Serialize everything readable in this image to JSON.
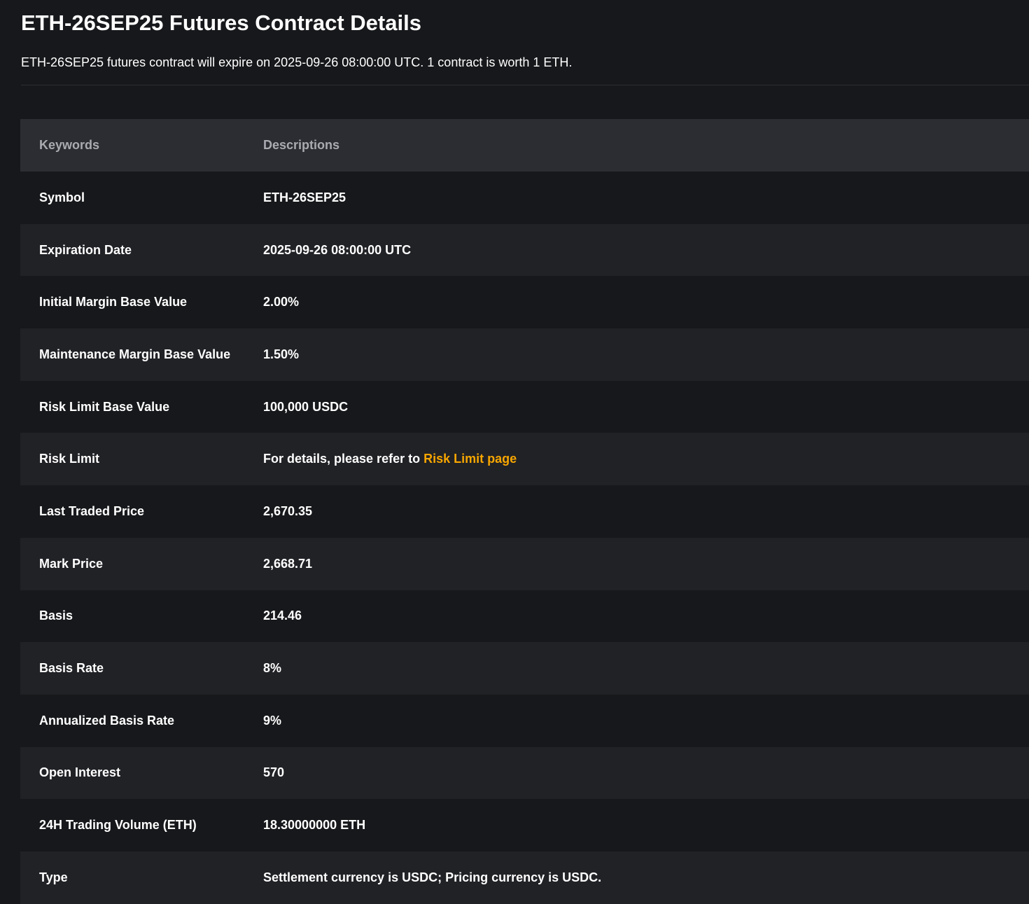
{
  "page": {
    "title": "ETH-26SEP25 Futures Contract Details",
    "subtitle": "ETH-26SEP25 futures contract will expire on 2025-09-26 08:00:00 UTC. 1 contract is worth 1 ETH."
  },
  "table": {
    "headers": {
      "keyword": "Keywords",
      "description": "Descriptions"
    },
    "rows": [
      {
        "key": "Symbol",
        "value": "ETH-26SEP25"
      },
      {
        "key": "Expiration Date",
        "value": "2025-09-26 08:00:00 UTC"
      },
      {
        "key": "Initial Margin Base Value",
        "value": "2.00%"
      },
      {
        "key": "Maintenance Margin Base Value",
        "value": "1.50%"
      },
      {
        "key": "Risk Limit Base Value",
        "value": "100,000 USDC"
      },
      {
        "key": "Risk Limit",
        "value": "For details, please refer to ",
        "link": "Risk Limit page"
      },
      {
        "key": "Last Traded Price",
        "value": "2,670.35"
      },
      {
        "key": "Mark Price",
        "value": "2,668.71"
      },
      {
        "key": "Basis",
        "value": "214.46"
      },
      {
        "key": "Basis Rate",
        "value": "8%"
      },
      {
        "key": "Annualized Basis Rate",
        "value": "9%"
      },
      {
        "key": "Open Interest",
        "value": "570"
      },
      {
        "key": "24H Trading Volume (ETH)",
        "value": "18.30000000 ETH"
      },
      {
        "key": "Type",
        "value": "Settlement currency is USDC; Pricing currency is USDC."
      }
    ]
  },
  "colors": {
    "background": "#17181b",
    "row_alt": "#212226",
    "header_bg": "#2b2d33",
    "link": "#f7a600"
  }
}
